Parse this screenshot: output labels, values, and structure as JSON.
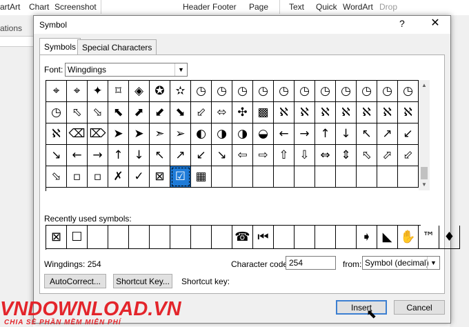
{
  "ribbon": {
    "items": [
      "artArt",
      "Chart",
      "Screenshot",
      "Header",
      "Footer",
      "Page",
      "Text",
      "Quick",
      "WordArt",
      "Drop"
    ],
    "left_label": "ations"
  },
  "dialog": {
    "title": "Symbol",
    "help": "?",
    "close": "✕",
    "tabs": [
      "Symbols",
      "Special Characters"
    ],
    "font_label": "Font:",
    "font_value": "Wingdings",
    "symbols": [
      [
        "⌖",
        "⌖",
        "✦",
        "⌑",
        "◈",
        "✪",
        "✫",
        "◷",
        "◷",
        "◷",
        "◷",
        "◷",
        "◷",
        "◷",
        "◷",
        "◷",
        "◷",
        "◷"
      ],
      [
        "◷",
        "⬁",
        "⬂",
        "⬉",
        "⬈",
        "⬋",
        "⬊",
        "⬃",
        "⬄",
        "✣",
        "▩",
        "ℵ",
        "ℵ",
        "ℵ",
        "ℵ",
        "ℵ",
        "ℵ",
        "ℵ"
      ],
      [
        "ℵ",
        "⌫",
        "⌦",
        "➤",
        "➤",
        "➣",
        "➢",
        "◐",
        "◑",
        "◑",
        "◒",
        "←",
        "→",
        "↑",
        "↓",
        "↖",
        "↗",
        "↙"
      ],
      [
        "↘",
        "←",
        "→",
        "↑",
        "↓",
        "↖",
        "↗",
        "↙",
        "↘",
        "⇦",
        "⇨",
        "⇧",
        "⇩",
        "⇔",
        "⇕",
        "⬁",
        "⬀",
        "⬃"
      ],
      [
        "⬂",
        "▫",
        "▫",
        "✗",
        "✓",
        "⊠",
        "☑",
        "▦",
        "",
        "",
        "",
        "",
        "",
        "",
        "",
        "",
        "",
        ""
      ]
    ],
    "selected_index": [
      4,
      6
    ],
    "recently_used_label": "Recently used symbols:",
    "recent": [
      "⊠",
      "☐",
      "",
      "",
      "",
      "",
      "",
      "",
      "",
      "☎",
      "⏮",
      "",
      "",
      "",
      "",
      "➧",
      "◣",
      "✋",
      "™",
      "♦"
    ],
    "status_name": "Wingdings: 254",
    "char_code_label": "Character code:",
    "char_code_value": "254",
    "from_label": "from:",
    "from_value": "Symbol (decimal)",
    "autocorrect_label": "AutoCorrect...",
    "shortcut_key_button": "Shortcut Key...",
    "shortcut_key_label": "Shortcut key:",
    "insert_label": "Insert",
    "cancel_label": "Cancel"
  },
  "watermark": {
    "brand": "VNDOWNLOAD.VN",
    "tagline": "CHIA SẺ PHẦN MỀM MIỄN PHÍ"
  }
}
